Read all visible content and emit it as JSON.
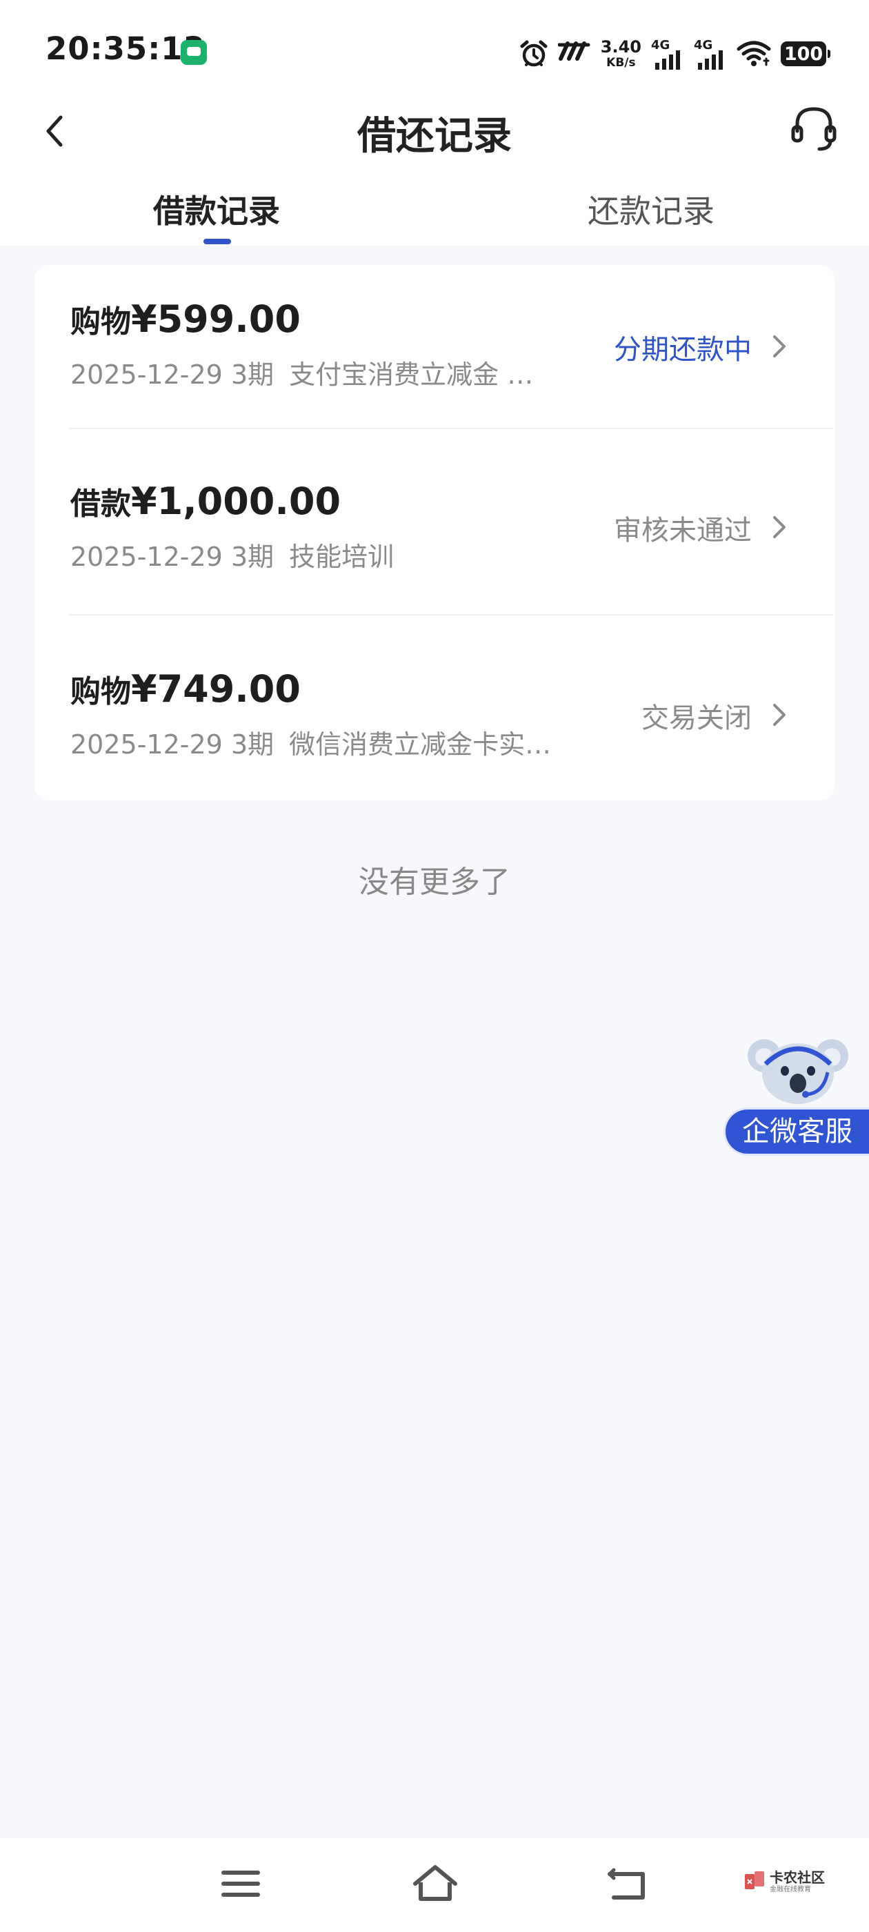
{
  "status_bar": {
    "time": "20:35:13",
    "speed_value": "3.40",
    "speed_unit": "KB/s",
    "signal_1_label": "4G",
    "signal_2_label": "4G",
    "battery": "100",
    "icons": [
      "app-notification-icon",
      "alarm-icon",
      "nfc-icon",
      "signal-icon",
      "wifi-icon",
      "battery-icon"
    ]
  },
  "header": {
    "title": "借还记录",
    "back_icon": "chevron-left-icon",
    "service_icon": "headset-icon"
  },
  "tabs": [
    {
      "label": "借款记录",
      "active": true
    },
    {
      "label": "还款记录",
      "active": false
    }
  ],
  "records": [
    {
      "type": "购物",
      "amount": "¥599.00",
      "date": "2025-12-29",
      "periods": "3期",
      "description": "支付宝消费立减金 …",
      "status": "分期还款中",
      "status_color": "#2f53c8"
    },
    {
      "type": "借款",
      "amount": "¥1,000.00",
      "date": "2025-12-29",
      "periods": "3期",
      "description": "技能培训",
      "status": "审核未通过",
      "status_color": "#8a8a8a"
    },
    {
      "type": "购物",
      "amount": "¥749.00",
      "date": "2025-12-29",
      "periods": "3期",
      "description": "微信消费立减金卡实…",
      "status": "交易关闭",
      "status_color": "#8a8a8a"
    }
  ],
  "list_end_text": "没有更多了",
  "float_service": {
    "label": "企微客服",
    "icon": "koala-mascot-icon"
  },
  "nav_bar": {
    "icons": [
      "menu-icon",
      "home-icon",
      "back-icon"
    ]
  },
  "watermark": {
    "title": "卡农社区",
    "subtitle": "金融在线教育"
  },
  "colors": {
    "accent": "#2f53c8",
    "page_background": "#f7f8fc",
    "muted_text": "#8a8a8a"
  }
}
